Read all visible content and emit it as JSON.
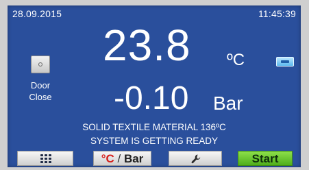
{
  "header": {
    "date": "28.09.2015",
    "time": "11:45:39"
  },
  "temperature": {
    "value": "23.8",
    "unit": "ºC"
  },
  "pressure": {
    "value": "-0.10",
    "unit": "Bar"
  },
  "door": {
    "label_line1": "Door",
    "label_line2": "Close"
  },
  "status": {
    "line1": "SOLID TEXTILE MATERIAL 136ºC",
    "line2": "SYSTEM IS GETTING READY"
  },
  "buttons": {
    "units_c": "°C",
    "units_slash": " / ",
    "units_bar": "Bar",
    "start": "Start"
  },
  "icons": {
    "menu": "grid-icon",
    "settings": "wrench-icon",
    "door": "door-icon",
    "usb": "usb-icon"
  },
  "colors": {
    "screen_bg": "#2a4f9c",
    "start_button": "#5cbf25",
    "units_accent": "#d6201c"
  }
}
